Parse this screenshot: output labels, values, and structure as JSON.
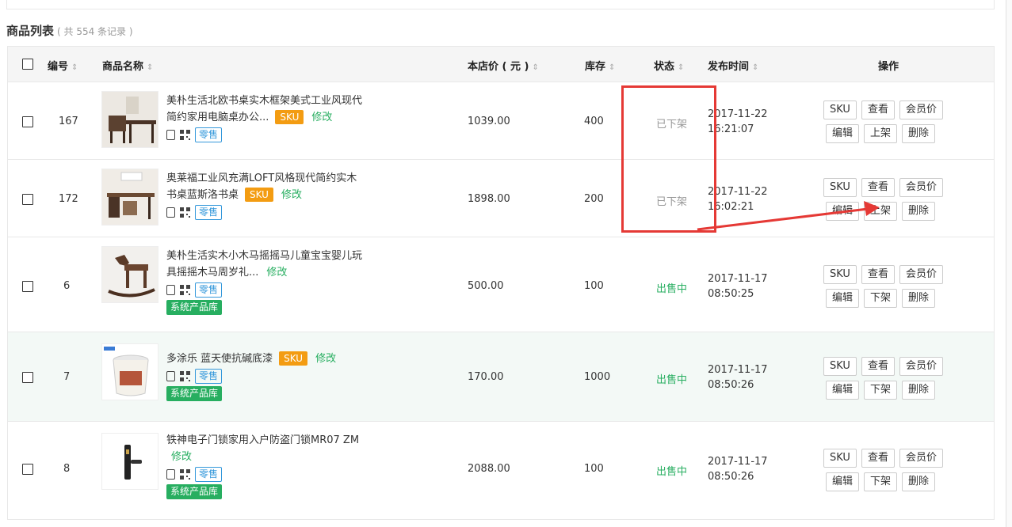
{
  "list": {
    "title": "商品列表",
    "count_text": "( 共 554 条记录 )"
  },
  "headers": {
    "id": "编号",
    "name": "商品名称",
    "price": "本店价 ( 元 )",
    "stock": "库存",
    "status": "状态",
    "time": "发布时间",
    "ops": "操作",
    "sort_icon": "⇕"
  },
  "labels": {
    "sku": "SKU",
    "edit_link": "修改",
    "retail": "零售",
    "library": "系统产品库",
    "op_sku": "SKU",
    "op_view": "查看",
    "op_member_price": "会员价",
    "op_edit": "编辑",
    "op_delete": "删除"
  },
  "rows": [
    {
      "id": "167",
      "name_l1": "美朴生活北欧书桌实木框架美式工业风现代",
      "name_l2": "简约家用电脑桌办公...",
      "price": "1039.00",
      "stock": "400",
      "status": "已下架",
      "date": "2017-11-22",
      "clock": "16:21:07",
      "toggle": "上架"
    },
    {
      "id": "172",
      "name_l1": "奥莱福工业风充满LOFT风格现代简约实木",
      "name_l2": "书桌蓝斯洛书桌",
      "price": "1898.00",
      "stock": "200",
      "status": "已下架",
      "date": "2017-11-22",
      "clock": "16:02:21",
      "toggle": "上架"
    },
    {
      "id": "6",
      "name_l1": "美朴生活实木小木马摇摇马儿童宝宝婴儿玩",
      "name_l2": "具摇摇木马周岁礼...",
      "price": "500.00",
      "stock": "100",
      "status": "出售中",
      "date": "2017-11-17",
      "clock": "08:50:25",
      "toggle": "下架"
    },
    {
      "id": "7",
      "name_l1": "多涂乐 蓝天使抗碱底漆",
      "price": "170.00",
      "stock": "1000",
      "status": "出售中",
      "date": "2017-11-17",
      "clock": "08:50:26",
      "toggle": "下架"
    },
    {
      "id": "8",
      "name_l1": "铁神电子门锁家用入户防盗门锁MR07 ZM",
      "price": "2088.00",
      "stock": "100",
      "status": "出售中",
      "date": "2017-11-17",
      "clock": "08:50:26",
      "toggle": "下架"
    }
  ],
  "colors": {
    "annotation": "#e53935",
    "on_sale": "#27ae60",
    "sku_tag": "#f39c12",
    "retail_tag": "#3498db"
  }
}
